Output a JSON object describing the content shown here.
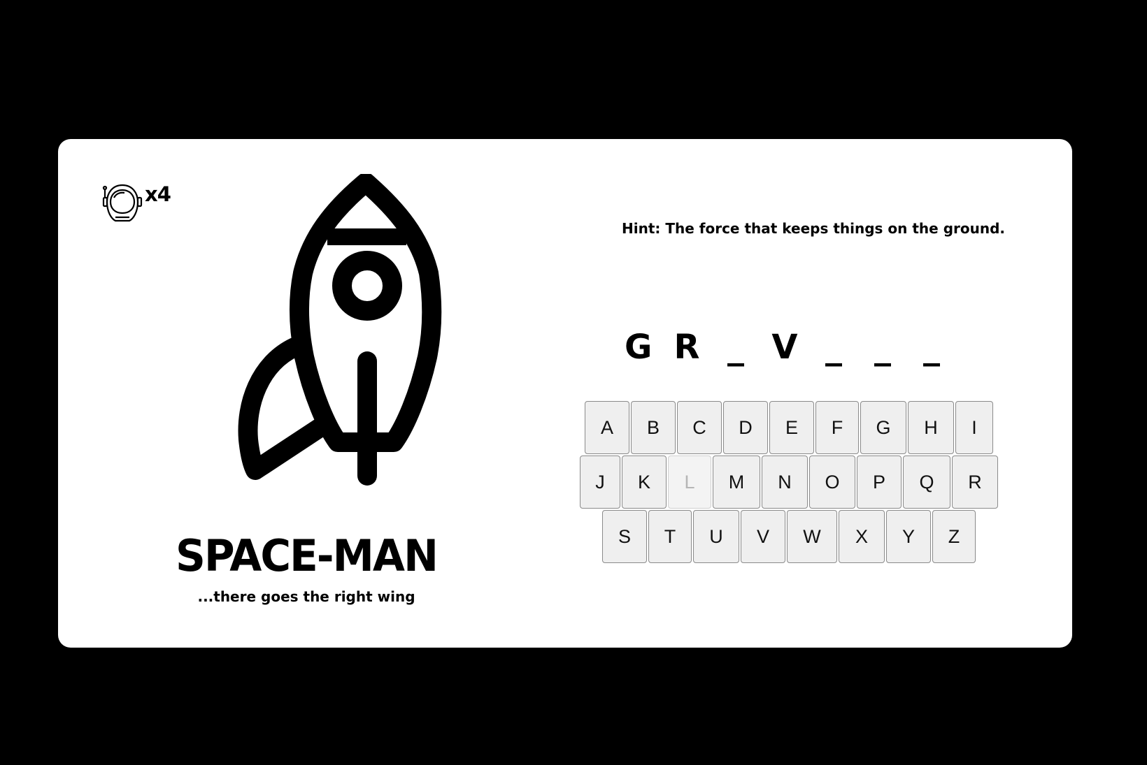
{
  "lives": {
    "icon": "astronaut-helmet-icon",
    "count_label": "x4"
  },
  "illustration": {
    "icon": "rocket-icon"
  },
  "title": "SPACE-MAN",
  "subtitle": "...there goes the right wing",
  "hint": "Hint: The force that keeps things on the ground.",
  "word": [
    "G",
    "R",
    "_",
    "V",
    "_",
    "_",
    "_"
  ],
  "keyboard": {
    "rows": [
      [
        {
          "label": "A",
          "used": false
        },
        {
          "label": "B",
          "used": false
        },
        {
          "label": "C",
          "used": false
        },
        {
          "label": "D",
          "used": false
        },
        {
          "label": "E",
          "used": false
        },
        {
          "label": "F",
          "used": false
        },
        {
          "label": "G",
          "used": false
        },
        {
          "label": "H",
          "used": false
        },
        {
          "label": "I",
          "used": false
        }
      ],
      [
        {
          "label": "J",
          "used": false
        },
        {
          "label": "K",
          "used": false
        },
        {
          "label": "L",
          "used": true
        },
        {
          "label": "M",
          "used": false
        },
        {
          "label": "N",
          "used": false
        },
        {
          "label": "O",
          "used": false
        },
        {
          "label": "P",
          "used": false
        },
        {
          "label": "Q",
          "used": false
        },
        {
          "label": "R",
          "used": false
        }
      ],
      [
        {
          "label": "S",
          "used": false
        },
        {
          "label": "T",
          "used": false
        },
        {
          "label": "U",
          "used": false
        },
        {
          "label": "V",
          "used": false
        },
        {
          "label": "W",
          "used": false
        },
        {
          "label": "X",
          "used": false
        },
        {
          "label": "Y",
          "used": false
        },
        {
          "label": "Z",
          "used": false
        }
      ]
    ]
  }
}
